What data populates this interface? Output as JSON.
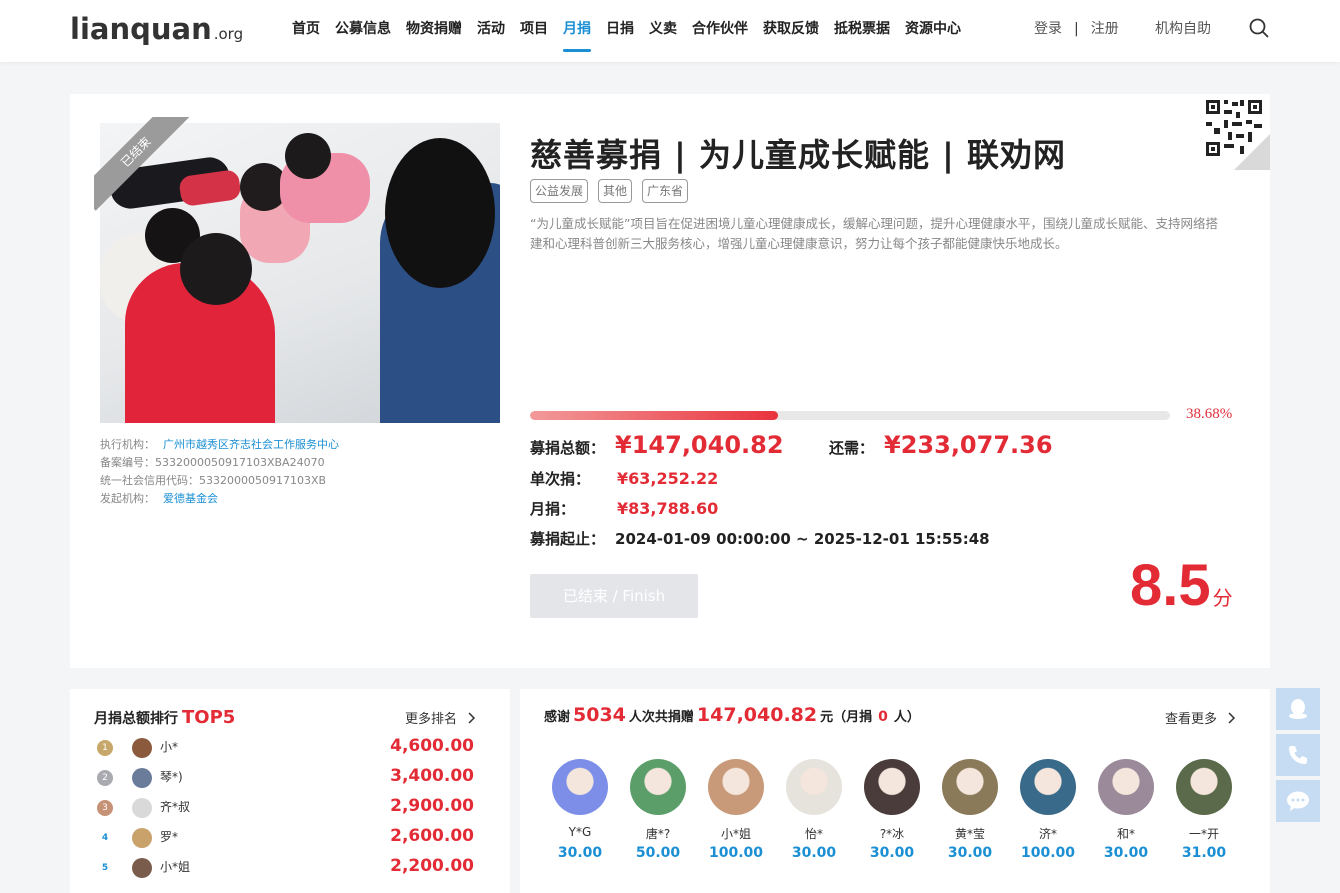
{
  "header": {
    "logo_text": "lianquan",
    "logo_domain": ".org",
    "nav": [
      "首页",
      "公募信息",
      "物资捐赠",
      "活动",
      "项目",
      "月捐",
      "日捐",
      "义卖",
      "合作伙伴",
      "获取反馈",
      "抵税票据",
      "资源中心"
    ],
    "active_nav": "月捐",
    "login": "登录",
    "separator": "|",
    "register": "注册",
    "org_self": "机构自助"
  },
  "project": {
    "ribbon": "已结束",
    "title": "慈善募捐 | 为儿童成长赋能 | 联劝网",
    "tags": [
      "公益发展",
      "其他",
      "广东省"
    ],
    "description": "“为儿童成长赋能”项目旨在促进困境儿童心理健康成长，缓解心理问题，提升心理健康水平，围绕儿童成长赋能、支持网络搭建和心理科普创新三大服务核心，增强儿童心理健康意识，努力让每个孩子都能健康快乐地成长。",
    "meta": {
      "exec_label": "执行机构：",
      "exec_org": "广州市越秀区齐志社会工作服务中心",
      "record_label": "备案编号：",
      "record_no": "5332000050917103XBA24070",
      "credit_label": "统一社会信用代码：",
      "credit_code": "5332000050917103XB",
      "initiator_label": "发起机构：",
      "initiator": "爱德基金会"
    },
    "progress": 0.3868,
    "progress_text": "38.68%",
    "raised_label": "募捐总额：",
    "raised": "¥147,040.82",
    "remaining_label": "还需：",
    "remaining": "¥233,077.36",
    "single_label": "单次捐：",
    "single": "¥63,252.22",
    "monthly_label": "月捐：",
    "monthly": "¥83,788.60",
    "period_label": "募捐起止：",
    "period": "2024-01-09 00:00:00 ~ 2025-12-01 15:55:48",
    "button": "已结束 / Finish",
    "score": "8.5",
    "score_unit": "分"
  },
  "ranking": {
    "title": "月捐总额排行",
    "title_highlight": "TOP5",
    "more": "更多排名",
    "rows": [
      {
        "rank": "1",
        "name": "小*",
        "amount": "4,600.00",
        "avatar": "#8b5a3c"
      },
      {
        "rank": "2",
        "name": "琴*)",
        "amount": "3,400.00",
        "avatar": "#6a7c9a"
      },
      {
        "rank": "3",
        "name": "齐*叔",
        "amount": "2,900.00",
        "avatar": "#d9d9d9"
      },
      {
        "rank": "4",
        "name": "罗*",
        "amount": "2,600.00",
        "avatar": "#c8a26a"
      },
      {
        "rank": "5",
        "name": "小*姐",
        "amount": "2,200.00",
        "avatar": "#7a5c4c"
      }
    ]
  },
  "thanks": {
    "prefix": "感谢",
    "count": "5034",
    "mid1": "人次共捐赠",
    "amount": "147,040.82",
    "mid2": "元（月捐",
    "monthly_count": "0",
    "suffix": "人）",
    "more": "查看更多",
    "donors": [
      {
        "name": "Y*G",
        "amount": "30.00",
        "color": "#7c8ee8"
      },
      {
        "name": "唐*?",
        "amount": "50.00",
        "color": "#5c9e6a"
      },
      {
        "name": "小*姐",
        "amount": "100.00",
        "color": "#c89a7a"
      },
      {
        "name": "怡*",
        "amount": "30.00",
        "color": "#e6e2dc"
      },
      {
        "name": "?*冰",
        "amount": "30.00",
        "color": "#4a3c3a"
      },
      {
        "name": "黄*莹",
        "amount": "30.00",
        "color": "#8a7a5a"
      },
      {
        "name": "济*",
        "amount": "100.00",
        "color": "#3a6a8a"
      },
      {
        "name": "和*",
        "amount": "30.00",
        "color": "#9a8a9a"
      },
      {
        "name": "一*开",
        "amount": "31.00",
        "color": "#5a6a4a"
      }
    ]
  }
}
